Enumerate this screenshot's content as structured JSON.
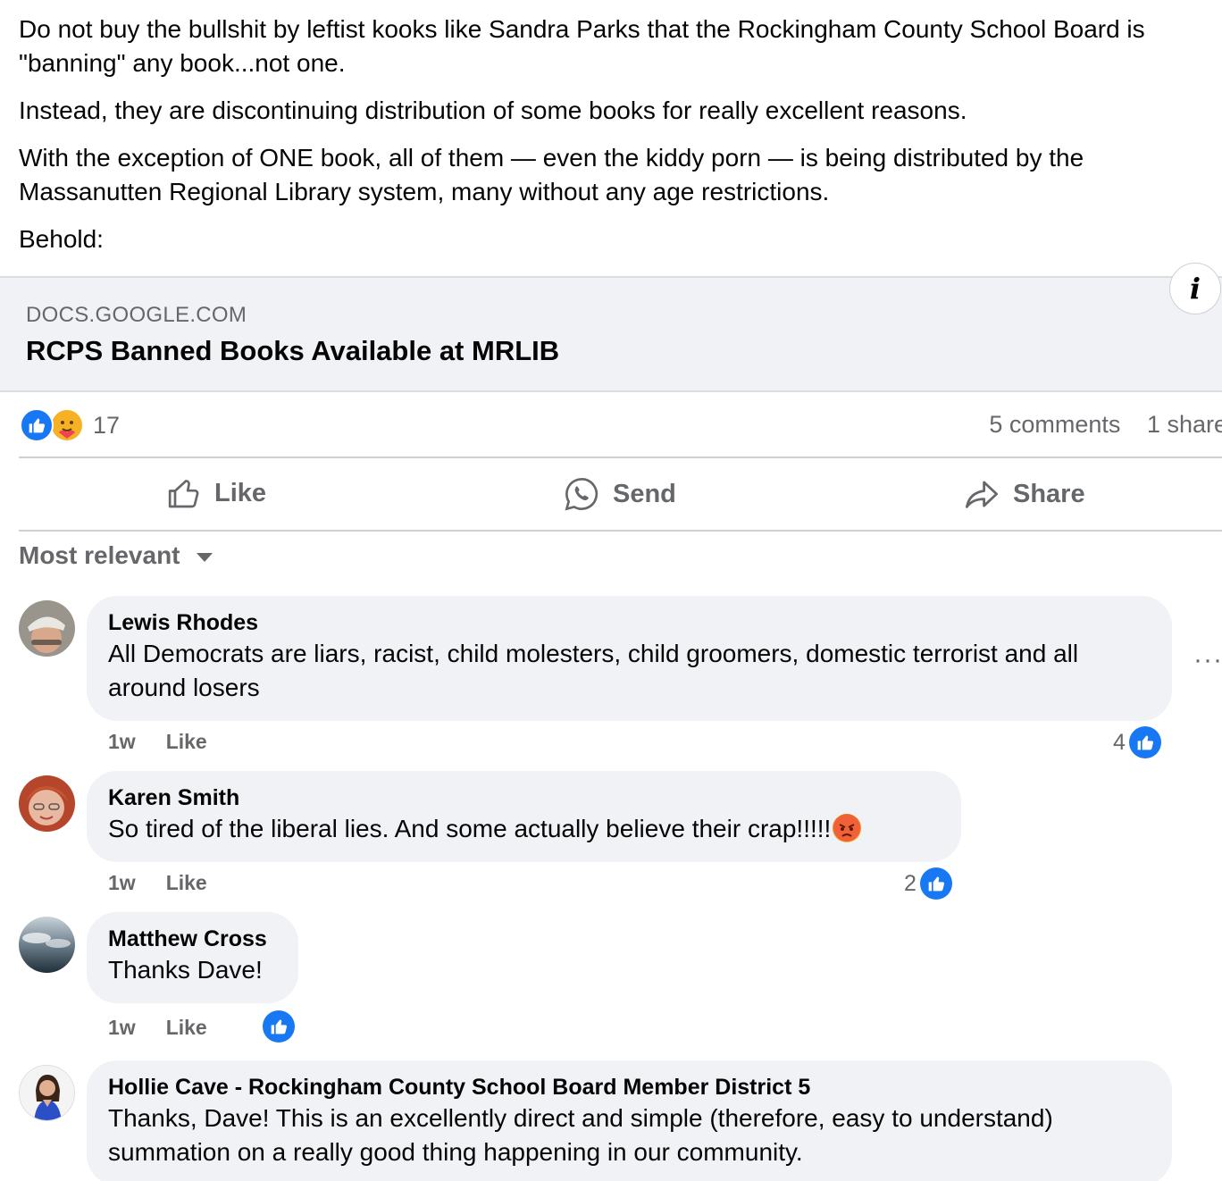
{
  "post": {
    "paragraphs": [
      "Do not buy the bullshit by leftist kooks like Sandra Parks that the Rockingham County School Board is \"banning\" any book...not one.",
      "Instead, they are discontinuing distribution of some books for really excellent reasons.",
      "With the exception of ONE book, all of them — even the kiddy porn — is being distributed by the Massanutten Regional Library system, many without any age restrictions.",
      "Behold:"
    ]
  },
  "link_preview": {
    "domain": "DOCS.GOOGLE.COM",
    "title": "RCPS Banned Books Available at MRLIB",
    "info_glyph": "i"
  },
  "stats": {
    "reaction_icons": [
      "like-icon",
      "care-icon"
    ],
    "reaction_count": "17",
    "comments": "5 comments",
    "shares": "1 share"
  },
  "actions": {
    "like": "Like",
    "send": "Send",
    "share": "Share"
  },
  "sort_label": "Most relevant",
  "comments": [
    {
      "name": "Lewis Rhodes",
      "text": "All Democrats are liars, racist, child molesters, child groomers, domestic terrorist and all around losers",
      "time": "1w",
      "like_label": "Like",
      "like_count": "4",
      "avatar_icon": "person-with-cap-avatar"
    },
    {
      "name": "Karen Smith",
      "text": "So tired of the liberal lies. And some actually believe their crap!!!!!",
      "emoji": "angry-face-icon",
      "time": "1w",
      "like_label": "Like",
      "like_count": "2",
      "avatar_icon": "woman-avatar"
    },
    {
      "name": "Matthew Cross",
      "text": "Thanks Dave!",
      "time": "1w",
      "like_label": "Like",
      "like_count": "",
      "avatar_icon": "cloudy-sky-avatar"
    },
    {
      "name": "Hollie Cave - Rockingham County School Board Member District 5",
      "text": "Thanks, Dave! This is an excellently direct and simple (therefore, easy to understand) summation on a really good thing happening in our community.",
      "avatar_icon": "woman-blue-dress-avatar"
    }
  ],
  "colors": {
    "brand_blue": "#1877f2",
    "secondary_text": "#65676b",
    "bubble_bg": "#f0f2f5"
  }
}
